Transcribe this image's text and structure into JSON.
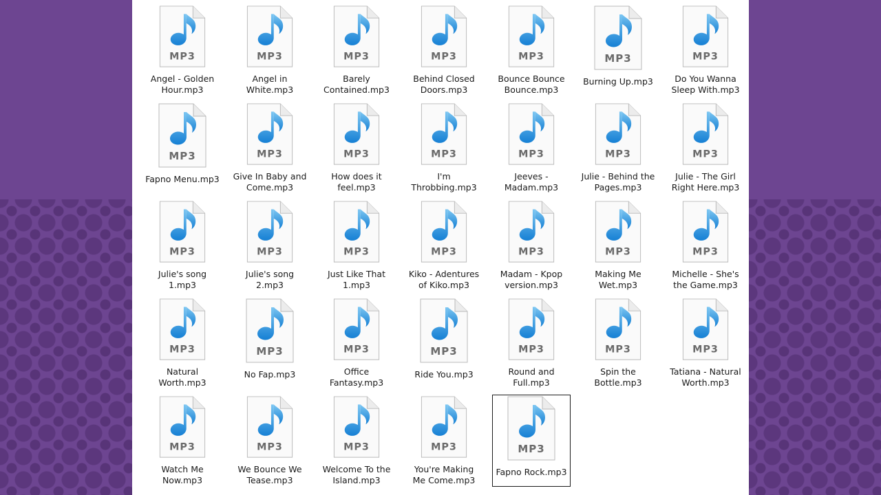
{
  "window": {
    "selected_index": 32,
    "icon_type": "mp3-file-icon",
    "icon_badge": "MP3",
    "colors": {
      "note_light": "#7cc6f2",
      "note_dark": "#1680d4",
      "badge_text": "#6a6a6a",
      "page_bg": "#ffffff",
      "desktop_bg": "#6d4591"
    },
    "files": [
      {
        "label": "Angel - Golden Hour.mp3"
      },
      {
        "label": "Angel in White.mp3"
      },
      {
        "label": "Barely Contained.mp3"
      },
      {
        "label": "Behind Closed Doors.mp3"
      },
      {
        "label": "Bounce Bounce Bounce.mp3"
      },
      {
        "label": "Burning Up.mp3"
      },
      {
        "label": "Do You Wanna Sleep With.mp3"
      },
      {
        "label": "Fapno Menu.mp3"
      },
      {
        "label": "Give In Baby and Come.mp3"
      },
      {
        "label": "How does it feel.mp3"
      },
      {
        "label": "I'm Throbbing.mp3"
      },
      {
        "label": "Jeeves - Madam.mp3"
      },
      {
        "label": "Julie - Behind the Pages.mp3"
      },
      {
        "label": "Julie - The Girl Right Here.mp3"
      },
      {
        "label": "Julie's song 1.mp3"
      },
      {
        "label": "Julie's song 2.mp3"
      },
      {
        "label": "Just Like That 1.mp3"
      },
      {
        "label": "Kiko - Adentures of Kiko.mp3"
      },
      {
        "label": "Madam - Kpop version.mp3"
      },
      {
        "label": "Making Me Wet.mp3"
      },
      {
        "label": "Michelle - She's the Game.mp3"
      },
      {
        "label": "Natural Worth.mp3"
      },
      {
        "label": "No Fap.mp3"
      },
      {
        "label": "Office Fantasy.mp3"
      },
      {
        "label": "Ride You.mp3"
      },
      {
        "label": "Round and Full.mp3"
      },
      {
        "label": "Spin the Bottle.mp3"
      },
      {
        "label": "Tatiana - Natural Worth.mp3"
      },
      {
        "label": "Watch Me Now.mp3"
      },
      {
        "label": "We Bounce We Tease.mp3"
      },
      {
        "label": "Welcome To the Island.mp3"
      },
      {
        "label": "You're Making Me Come.mp3"
      },
      {
        "label": "Fapno Rock.mp3"
      }
    ]
  }
}
